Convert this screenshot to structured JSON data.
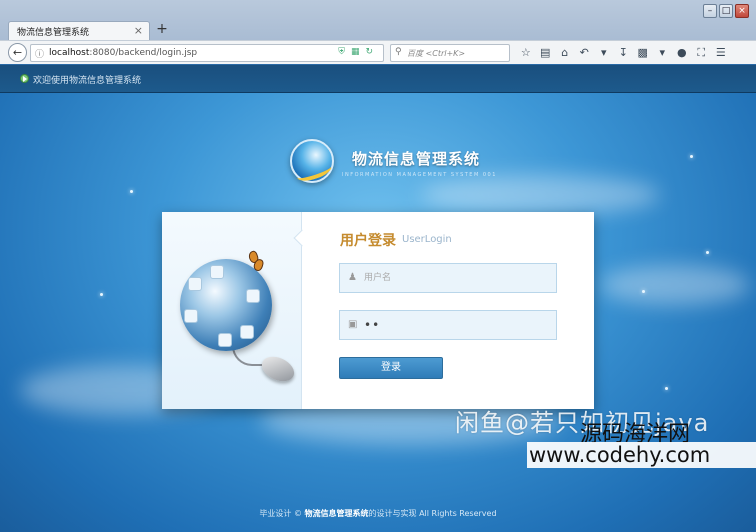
{
  "browser": {
    "tab_title": "物流信息管理系统",
    "tab_close": "×",
    "new_tab": "+",
    "url_host": "localhost",
    "url_rest": ":8080/backend/login.jsp",
    "search_placeholder": "百度 <Ctrl+K>",
    "window_controls": [
      "–",
      "□",
      "×"
    ]
  },
  "page": {
    "topbar_text": "欢迎使用物流信息管理系统",
    "system_title": "物流信息管理系统",
    "system_subtitle": "INFORMATION MANAGEMENT SYSTEM 001",
    "login": {
      "title": "用户登录",
      "title_en": "UserLogin",
      "username_placeholder": "用户名",
      "password_dots": "••",
      "submit_label": "登录"
    },
    "footer": {
      "prefix": "毕业设计 © ",
      "system_name": "物流信息管理系统",
      "suffix": "的设计与实现 All Rights Reserved"
    }
  },
  "watermark": {
    "line1": "闲鱼@若只如初见java",
    "line2": "源码海洋网",
    "line3": "www.codehy.com"
  },
  "colors": {
    "accent": "#c58b2e",
    "button": "#2f7cb8",
    "topbar": "#1d5a8c",
    "field_bg": "#eaf4fb"
  }
}
